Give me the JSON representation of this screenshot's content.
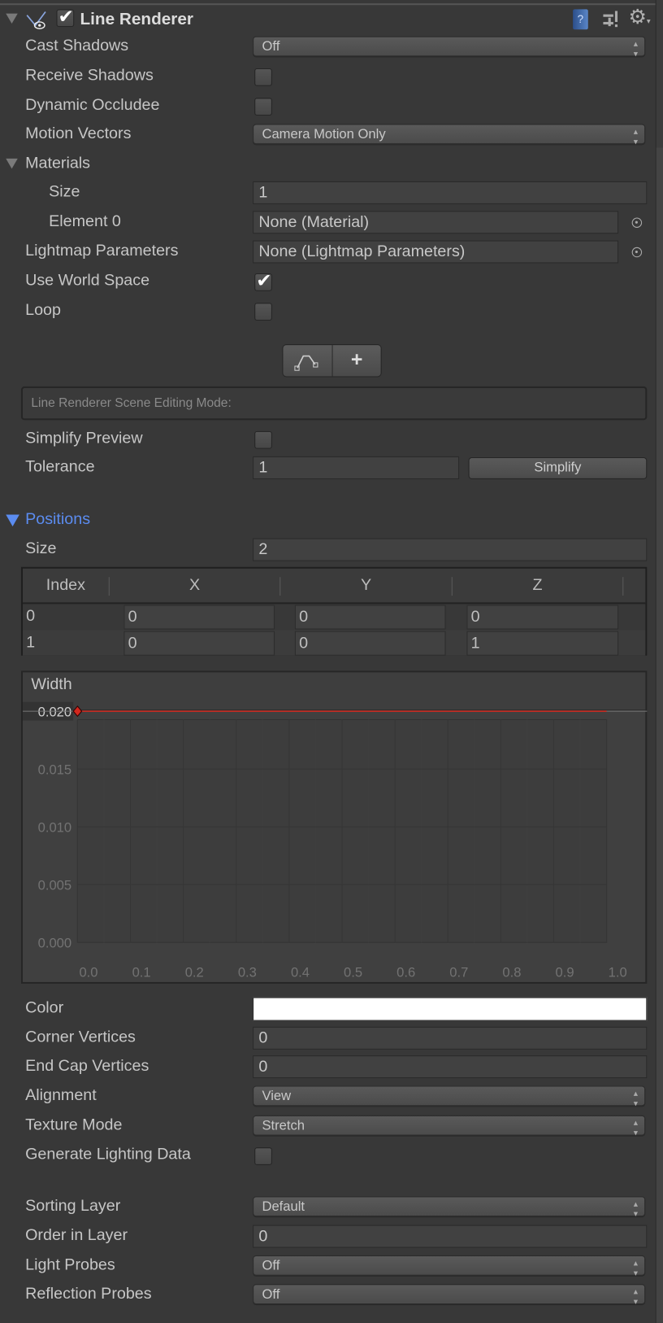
{
  "header": {
    "title": "Line Renderer",
    "enabled": true,
    "icons": [
      "visibility-icon",
      "help-book-icon",
      "presets-icon",
      "gear-icon"
    ]
  },
  "fields": {
    "cast_shadows": {
      "label": "Cast Shadows",
      "value": "Off"
    },
    "receive_shadows": {
      "label": "Receive Shadows",
      "checked": false
    },
    "dynamic_occludee": {
      "label": "Dynamic Occludee",
      "checked": false
    },
    "motion_vectors": {
      "label": "Motion Vectors",
      "value": "Camera Motion Only"
    },
    "materials": {
      "label": "Materials",
      "size_label": "Size",
      "size": "1",
      "element0_label": "Element 0",
      "element0": "None (Material)"
    },
    "lightmap": {
      "label": "Lightmap Parameters",
      "value": "None (Lightmap Parameters)"
    },
    "use_world_space": {
      "label": "Use World Space",
      "checked": true
    },
    "loop": {
      "label": "Loop",
      "checked": false
    }
  },
  "editing": {
    "mode_text": "Line Renderer Scene Editing Mode:",
    "buttons": [
      "edit-points-icon",
      "add-point-icon"
    ],
    "add_glyph": "+"
  },
  "simplify": {
    "preview_label": "Simplify Preview",
    "preview_checked": false,
    "tolerance_label": "Tolerance",
    "tolerance": "1",
    "button": "Simplify"
  },
  "positions": {
    "label": "Positions",
    "size_label": "Size",
    "size": "2",
    "columns": [
      "Index",
      "X",
      "Y",
      "Z"
    ],
    "rows": [
      {
        "index": "0",
        "x": "0",
        "y": "0",
        "z": "0"
      },
      {
        "index": "1",
        "x": "0",
        "y": "0",
        "z": "1"
      }
    ]
  },
  "chart_data": {
    "type": "line",
    "title": "Width",
    "x": [
      0.0,
      1.0
    ],
    "y": [
      0.02,
      0.02
    ],
    "xlim": [
      0,
      1
    ],
    "ylim": [
      0,
      0.02
    ],
    "xticks": [
      "0.0",
      "0.1",
      "0.2",
      "0.3",
      "0.4",
      "0.5",
      "0.6",
      "0.7",
      "0.8",
      "0.9",
      "1.0"
    ],
    "yticks": [
      "0.000",
      "0.005",
      "0.010",
      "0.015",
      "0.020"
    ],
    "line_color": "#d2281e",
    "grid": true
  },
  "lower": {
    "color": {
      "label": "Color",
      "value": "#ffffff"
    },
    "corner_vertices": {
      "label": "Corner Vertices",
      "value": "0"
    },
    "end_cap_vertices": {
      "label": "End Cap Vertices",
      "value": "0"
    },
    "alignment": {
      "label": "Alignment",
      "value": "View"
    },
    "texture_mode": {
      "label": "Texture Mode",
      "value": "Stretch"
    },
    "generate_lighting": {
      "label": "Generate Lighting Data",
      "checked": false
    },
    "sorting_layer": {
      "label": "Sorting Layer",
      "value": "Default"
    },
    "order_in_layer": {
      "label": "Order in Layer",
      "value": "0"
    },
    "light_probes": {
      "label": "Light Probes",
      "value": "Off"
    },
    "reflection_probes": {
      "label": "Reflection Probes",
      "value": "Off"
    }
  },
  "colors": {
    "background": "#383838",
    "accent": "#5b8cf0"
  }
}
